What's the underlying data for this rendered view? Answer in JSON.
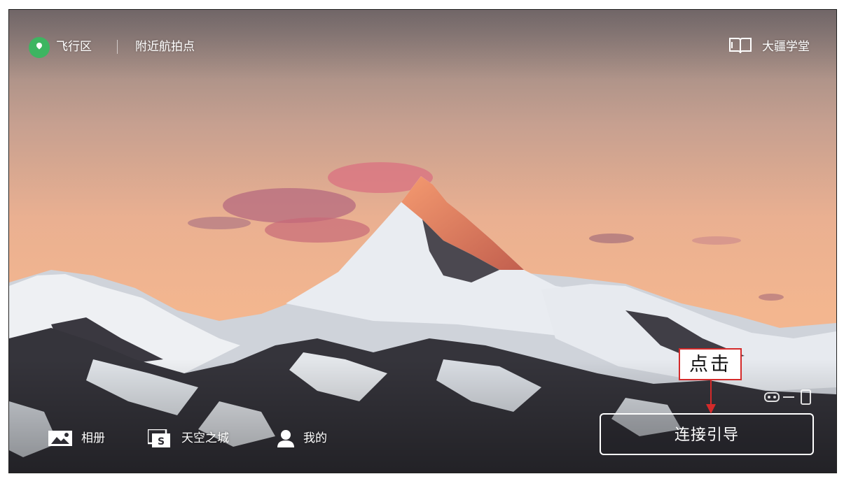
{
  "header": {
    "fly_zone_label": "飞行区",
    "nearby_spots_label": "附近航拍点",
    "academy_label": "大疆学堂"
  },
  "bottom_nav": {
    "album_label": "相册",
    "skypixel_label": "天空之城",
    "me_label": "我的"
  },
  "connect": {
    "label": "连接引导"
  },
  "annotation": {
    "label": "点击",
    "color": "#d42a2a"
  },
  "colors": {
    "fly_zone_pin": "#3db561",
    "sky_top": "#8f8480",
    "sky_mid": "#f1b08a",
    "snow": "#eef0f3",
    "rock": "#2d2c33"
  }
}
